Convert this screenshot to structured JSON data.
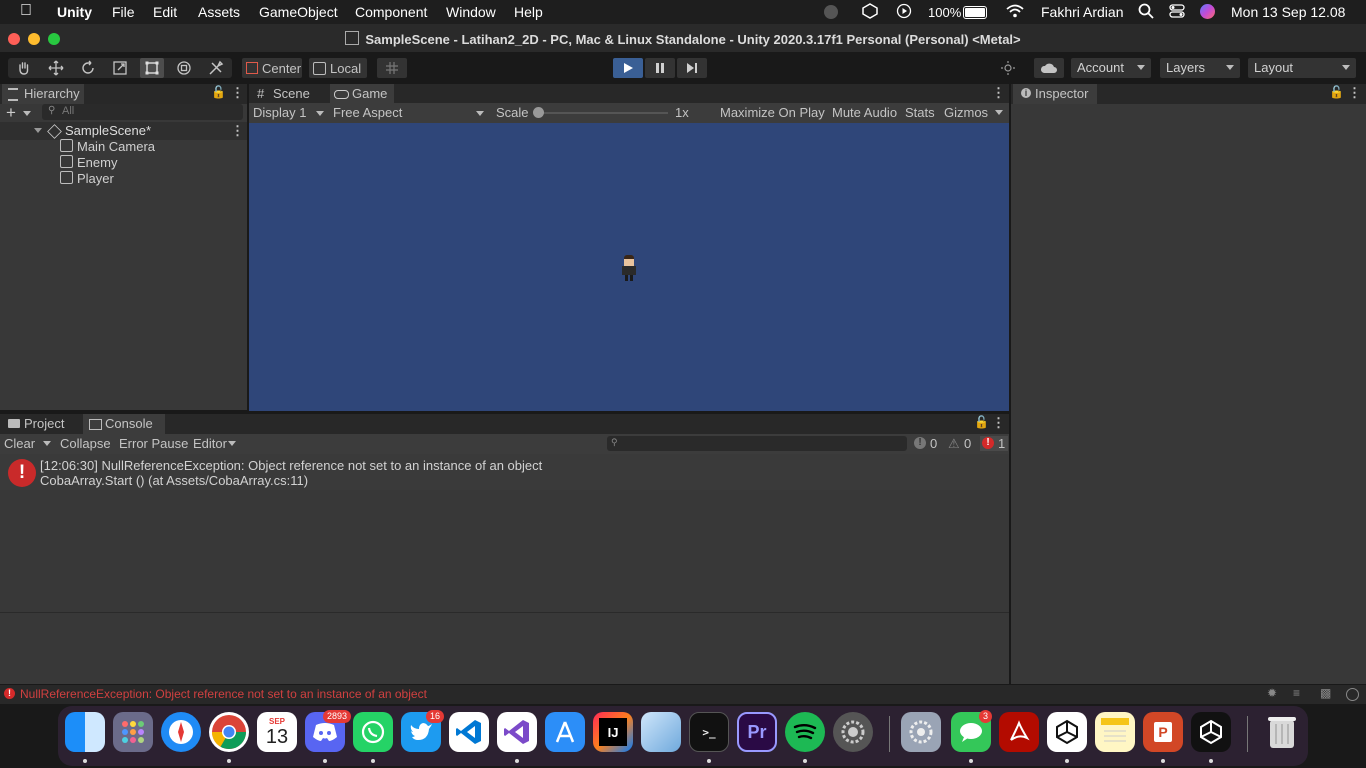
{
  "menubar": {
    "app": "Unity",
    "items": [
      "File",
      "Edit",
      "Assets",
      "GameObject",
      "Component",
      "Window",
      "Help"
    ],
    "battery": "100%",
    "user": "Fakhri Ardian",
    "datetime": "Mon 13 Sep  12.08"
  },
  "window": {
    "title": "SampleScene - Latihan2_2D - PC, Mac & Linux Standalone - Unity 2020.3.17f1 Personal (Personal) <Metal>"
  },
  "toolbar": {
    "pivot": "Center",
    "space": "Local",
    "account": "Account",
    "layers": "Layers",
    "layout": "Layout"
  },
  "hierarchy": {
    "tab": "Hierarchy",
    "search_placeholder": "All",
    "scene": "SampleScene*",
    "objects": [
      "Main Camera",
      "Enemy",
      "Player"
    ]
  },
  "game": {
    "tabs": [
      "Scene",
      "Game"
    ],
    "display": "Display 1",
    "aspect": "Free Aspect",
    "scale_label": "Scale",
    "scale_value": "1x",
    "maximize": "Maximize On Play",
    "mute": "Mute Audio",
    "stats": "Stats",
    "gizmos": "Gizmos",
    "background_color": "#2f4679"
  },
  "inspector": {
    "tab": "Inspector"
  },
  "console": {
    "tabs": [
      "Project",
      "Console"
    ],
    "clear": "Clear",
    "collapse": "Collapse",
    "error_pause": "Error Pause",
    "editor": "Editor",
    "log_count": "0",
    "warn_count": "0",
    "error_count": "1",
    "entry_line1": "[12:06:30] NullReferenceException: Object reference not set to an instance of an object",
    "entry_line2": "CobaArray.Start () (at Assets/CobaArray.cs:11)"
  },
  "statusbar": {
    "message": "NullReferenceException: Object reference not set to an instance of an object"
  },
  "dock": {
    "calendar_month": "SEP",
    "calendar_day": "13",
    "discord_badge": "2893",
    "twitter_badge": "16",
    "messages_badge": "3",
    "premiere": "Pr",
    "intellij": "IJ"
  }
}
